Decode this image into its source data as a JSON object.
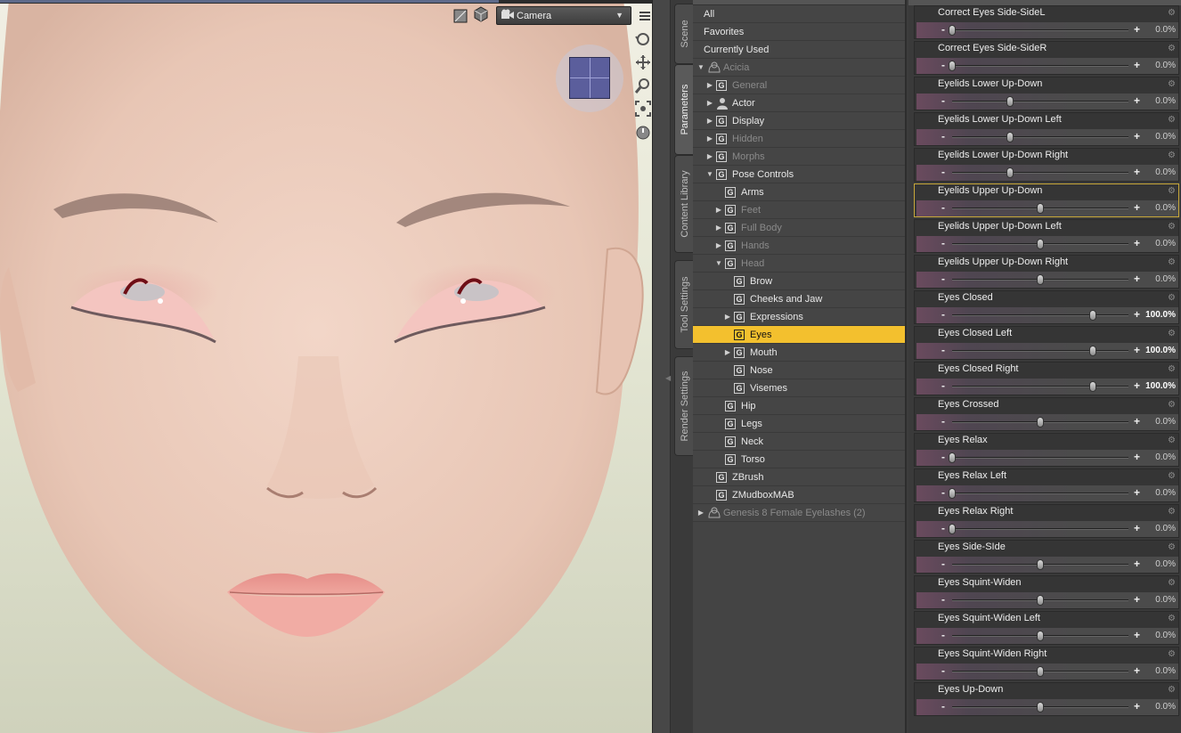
{
  "viewport": {
    "camera": {
      "label": "Camera",
      "icon": "camera-icon"
    }
  },
  "tabs": [
    {
      "label": "Scene",
      "active": false
    },
    {
      "label": "Parameters",
      "active": true
    },
    {
      "label": "Content Library",
      "active": false
    },
    {
      "label": "Tool Settings",
      "active": false
    },
    {
      "label": "Render Settings",
      "active": false
    }
  ],
  "tree": {
    "rows": [
      {
        "label": "All",
        "kind": "plain",
        "depth": 0
      },
      {
        "label": "Favorites",
        "kind": "plain",
        "depth": 0
      },
      {
        "label": "Currently Used",
        "kind": "plain",
        "depth": 0
      },
      {
        "label": "Acicia",
        "kind": "figure",
        "depth": 0,
        "arrow": "down",
        "dim": true
      },
      {
        "label": "General",
        "kind": "group",
        "depth": 1,
        "arrow": "right",
        "dim": true
      },
      {
        "label": "Actor",
        "kind": "actor",
        "depth": 1,
        "arrow": "right"
      },
      {
        "label": "Display",
        "kind": "group",
        "depth": 1,
        "arrow": "right"
      },
      {
        "label": "Hidden",
        "kind": "group",
        "depth": 1,
        "arrow": "right",
        "dim": true
      },
      {
        "label": "Morphs",
        "kind": "group",
        "depth": 1,
        "arrow": "right",
        "dim": true
      },
      {
        "label": "Pose Controls",
        "kind": "group",
        "depth": 1,
        "arrow": "down"
      },
      {
        "label": "Arms",
        "kind": "group",
        "depth": 2
      },
      {
        "label": "Feet",
        "kind": "group",
        "depth": 2,
        "arrow": "right",
        "dim": true
      },
      {
        "label": "Full Body",
        "kind": "group",
        "depth": 2,
        "arrow": "right",
        "dim": true
      },
      {
        "label": "Hands",
        "kind": "group",
        "depth": 2,
        "arrow": "right",
        "dim": true
      },
      {
        "label": "Head",
        "kind": "group",
        "depth": 2,
        "arrow": "down",
        "dim": true
      },
      {
        "label": "Brow",
        "kind": "group",
        "depth": 3
      },
      {
        "label": "Cheeks and Jaw",
        "kind": "group",
        "depth": 3
      },
      {
        "label": "Expressions",
        "kind": "group",
        "depth": 3,
        "arrow": "right"
      },
      {
        "label": "Eyes",
        "kind": "group",
        "depth": 3,
        "selected": true
      },
      {
        "label": "Mouth",
        "kind": "group",
        "depth": 3,
        "arrow": "right"
      },
      {
        "label": "Nose",
        "kind": "group",
        "depth": 3
      },
      {
        "label": "Visemes",
        "kind": "group",
        "depth": 3
      },
      {
        "label": "Hip",
        "kind": "group",
        "depth": 2
      },
      {
        "label": "Legs",
        "kind": "group",
        "depth": 2
      },
      {
        "label": "Neck",
        "kind": "group",
        "depth": 2
      },
      {
        "label": "Torso",
        "kind": "group",
        "depth": 2
      },
      {
        "label": "ZBrush",
        "kind": "group",
        "depth": 1
      },
      {
        "label": "ZMudboxMAB",
        "kind": "group",
        "depth": 1
      },
      {
        "label": "Genesis 8 Female Eyelashes (2)",
        "kind": "figure",
        "depth": 0,
        "arrow": "right",
        "dim": true
      }
    ]
  },
  "parameters": [
    {
      "name": "Correct Eyes Side-SideL",
      "value": "0.0%",
      "fraction": 0.0,
      "min_side": true
    },
    {
      "name": "Correct Eyes Side-SideR",
      "value": "0.0%",
      "fraction": 0.0,
      "min_side": true
    },
    {
      "name": "Eyelids Lower Up-Down",
      "value": "0.0%",
      "fraction": 0.33
    },
    {
      "name": "Eyelids Lower Up-Down Left",
      "value": "0.0%",
      "fraction": 0.33
    },
    {
      "name": "Eyelids Lower Up-Down Right",
      "value": "0.0%",
      "fraction": 0.33
    },
    {
      "name": "Eyelids Upper Up-Down",
      "value": "0.0%",
      "fraction": 0.5,
      "focused": true
    },
    {
      "name": "Eyelids Upper Up-Down Left",
      "value": "0.0%",
      "fraction": 0.5
    },
    {
      "name": "Eyelids Upper Up-Down Right",
      "value": "0.0%",
      "fraction": 0.5
    },
    {
      "name": "Eyes Closed",
      "value": "100.0%",
      "fraction": 0.8,
      "high": true
    },
    {
      "name": "Eyes Closed Left",
      "value": "100.0%",
      "fraction": 0.8,
      "high": true
    },
    {
      "name": "Eyes Closed Right",
      "value": "100.0%",
      "fraction": 0.8,
      "high": true
    },
    {
      "name": "Eyes Crossed",
      "value": "0.0%",
      "fraction": 0.5
    },
    {
      "name": "Eyes Relax",
      "value": "0.0%",
      "fraction": 0.0
    },
    {
      "name": "Eyes Relax Left",
      "value": "0.0%",
      "fraction": 0.0
    },
    {
      "name": "Eyes Relax Right",
      "value": "0.0%",
      "fraction": 0.0
    },
    {
      "name": "Eyes Side-SIde",
      "value": "0.0%",
      "fraction": 0.5
    },
    {
      "name": "Eyes Squint-Widen",
      "value": "0.0%",
      "fraction": 0.5
    },
    {
      "name": "Eyes Squint-Widen Left",
      "value": "0.0%",
      "fraction": 0.5
    },
    {
      "name": "Eyes Squint-Widen Right",
      "value": "0.0%",
      "fraction": 0.5
    },
    {
      "name": "Eyes Up-Down",
      "value": "0.0%",
      "fraction": 0.5
    }
  ],
  "colors": {
    "selection": "#f3c02e",
    "focus_border": "#c8a83a",
    "panel": "#444444"
  }
}
